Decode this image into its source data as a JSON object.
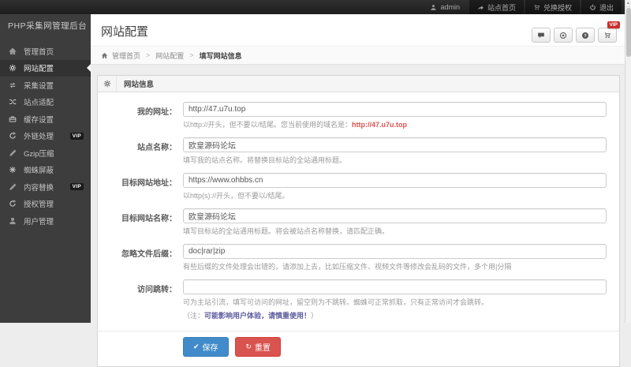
{
  "topbar": {
    "items": [
      {
        "label": "admin",
        "icon": "user-icon"
      },
      {
        "label": "站点首页",
        "icon": "share-arrow-icon"
      },
      {
        "label": "兑换授权",
        "icon": "cart-icon"
      },
      {
        "label": "退出",
        "icon": "power-icon"
      }
    ]
  },
  "sidebar": {
    "logo": "PHP采集网管理后台",
    "vip_badge": "VIP",
    "items": [
      {
        "label": "管理首页",
        "icon": "home-icon",
        "active": false
      },
      {
        "label": "网站配置",
        "icon": "gear-icon",
        "active": true
      },
      {
        "label": "采集设置",
        "icon": "repeat-icon",
        "active": false
      },
      {
        "label": "站点适配",
        "icon": "shuffle-icon",
        "active": false
      },
      {
        "label": "缓存设置",
        "icon": "briefcase-icon",
        "active": false
      },
      {
        "label": "外链处理",
        "icon": "refresh-icon",
        "active": false,
        "vip": true
      },
      {
        "label": "Gzip压缩",
        "icon": "pencil-icon",
        "active": false
      },
      {
        "label": "蜘蛛屏蔽",
        "icon": "spider-icon",
        "active": false
      },
      {
        "label": "内容替换",
        "icon": "pencil-icon",
        "active": false,
        "vip": true
      },
      {
        "label": "授权管理",
        "icon": "license-icon",
        "active": false
      },
      {
        "label": "用户管理",
        "icon": "user-icon",
        "active": false
      }
    ]
  },
  "header": {
    "title": "网站配置",
    "action_icons": [
      "comment-icon",
      "record-icon",
      "question-icon",
      "cart-icon"
    ],
    "vip_badge": "VIP"
  },
  "breadcrumb": {
    "items": [
      "管理首页",
      "网站配置",
      "填写网站信息"
    ]
  },
  "panel": {
    "title": "网站信息",
    "fields": [
      {
        "label": "我的网址：",
        "value": "http://47.u7u.top",
        "help": "以http://开头，但不要以/结尾。您当前使用的域名是：",
        "help_highlight": "http://47.u7u.top"
      },
      {
        "label": "站点名称：",
        "value": "欧皇源码论坛",
        "help": "填写我的站点名称。将替换目标站的全站通用标题。"
      },
      {
        "label": "目标网站地址：",
        "value": "https://www.ohbbs.cn",
        "help": "以http(s)://开头，但不要以/结尾。"
      },
      {
        "label": "目标网站名称：",
        "value": "欧皇源码论坛",
        "help": "填写目标站的全站通用标题。将会被站点名称替换，请匹配正确。"
      },
      {
        "label": "忽略文件后缀：",
        "value": "doc|rar|zip",
        "help": "有些后缀的文件处理会出错的，请添加上去，比如压缩文件、视频文件等修改会乱码的文件，多个用|分隔"
      },
      {
        "label": "访问跳转：",
        "value": "",
        "help": "可为主站引流，填写可访问的网址，留空则为不跳转。蜘蛛可正常抓取，只有正常访问才会跳转。",
        "note_prefix": "（注：",
        "note_bold": "可能影响用户体验，请慎重使用！",
        "note_suffix": "）"
      }
    ],
    "buttons": {
      "save": "保存",
      "reset": "重置",
      "save_glyph": "✔",
      "reset_glyph": "↻"
    }
  },
  "colors": {
    "topbar_bg": "#262626",
    "sidebar_bg": "#3d3d3d",
    "vip_red": "#c9302c",
    "highlight_red": "#d9534f",
    "note_blue": "#5b5b9e",
    "save_blue": "#428bca",
    "reset_red": "#d9534f"
  }
}
